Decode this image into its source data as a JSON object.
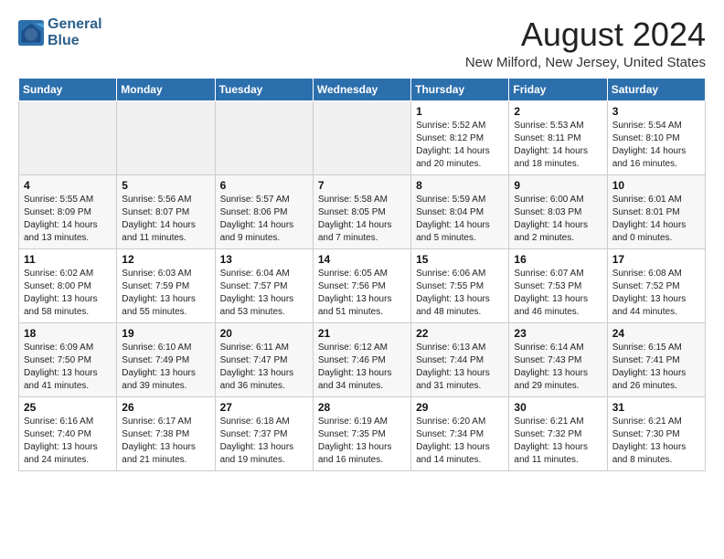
{
  "logo": {
    "line1": "General",
    "line2": "Blue"
  },
  "title": "August 2024",
  "location": "New Milford, New Jersey, United States",
  "weekdays": [
    "Sunday",
    "Monday",
    "Tuesday",
    "Wednesday",
    "Thursday",
    "Friday",
    "Saturday"
  ],
  "weeks": [
    [
      {
        "day": "",
        "info": ""
      },
      {
        "day": "",
        "info": ""
      },
      {
        "day": "",
        "info": ""
      },
      {
        "day": "",
        "info": ""
      },
      {
        "day": "1",
        "info": "Sunrise: 5:52 AM\nSunset: 8:12 PM\nDaylight: 14 hours\nand 20 minutes."
      },
      {
        "day": "2",
        "info": "Sunrise: 5:53 AM\nSunset: 8:11 PM\nDaylight: 14 hours\nand 18 minutes."
      },
      {
        "day": "3",
        "info": "Sunrise: 5:54 AM\nSunset: 8:10 PM\nDaylight: 14 hours\nand 16 minutes."
      }
    ],
    [
      {
        "day": "4",
        "info": "Sunrise: 5:55 AM\nSunset: 8:09 PM\nDaylight: 14 hours\nand 13 minutes."
      },
      {
        "day": "5",
        "info": "Sunrise: 5:56 AM\nSunset: 8:07 PM\nDaylight: 14 hours\nand 11 minutes."
      },
      {
        "day": "6",
        "info": "Sunrise: 5:57 AM\nSunset: 8:06 PM\nDaylight: 14 hours\nand 9 minutes."
      },
      {
        "day": "7",
        "info": "Sunrise: 5:58 AM\nSunset: 8:05 PM\nDaylight: 14 hours\nand 7 minutes."
      },
      {
        "day": "8",
        "info": "Sunrise: 5:59 AM\nSunset: 8:04 PM\nDaylight: 14 hours\nand 5 minutes."
      },
      {
        "day": "9",
        "info": "Sunrise: 6:00 AM\nSunset: 8:03 PM\nDaylight: 14 hours\nand 2 minutes."
      },
      {
        "day": "10",
        "info": "Sunrise: 6:01 AM\nSunset: 8:01 PM\nDaylight: 14 hours\nand 0 minutes."
      }
    ],
    [
      {
        "day": "11",
        "info": "Sunrise: 6:02 AM\nSunset: 8:00 PM\nDaylight: 13 hours\nand 58 minutes."
      },
      {
        "day": "12",
        "info": "Sunrise: 6:03 AM\nSunset: 7:59 PM\nDaylight: 13 hours\nand 55 minutes."
      },
      {
        "day": "13",
        "info": "Sunrise: 6:04 AM\nSunset: 7:57 PM\nDaylight: 13 hours\nand 53 minutes."
      },
      {
        "day": "14",
        "info": "Sunrise: 6:05 AM\nSunset: 7:56 PM\nDaylight: 13 hours\nand 51 minutes."
      },
      {
        "day": "15",
        "info": "Sunrise: 6:06 AM\nSunset: 7:55 PM\nDaylight: 13 hours\nand 48 minutes."
      },
      {
        "day": "16",
        "info": "Sunrise: 6:07 AM\nSunset: 7:53 PM\nDaylight: 13 hours\nand 46 minutes."
      },
      {
        "day": "17",
        "info": "Sunrise: 6:08 AM\nSunset: 7:52 PM\nDaylight: 13 hours\nand 44 minutes."
      }
    ],
    [
      {
        "day": "18",
        "info": "Sunrise: 6:09 AM\nSunset: 7:50 PM\nDaylight: 13 hours\nand 41 minutes."
      },
      {
        "day": "19",
        "info": "Sunrise: 6:10 AM\nSunset: 7:49 PM\nDaylight: 13 hours\nand 39 minutes."
      },
      {
        "day": "20",
        "info": "Sunrise: 6:11 AM\nSunset: 7:47 PM\nDaylight: 13 hours\nand 36 minutes."
      },
      {
        "day": "21",
        "info": "Sunrise: 6:12 AM\nSunset: 7:46 PM\nDaylight: 13 hours\nand 34 minutes."
      },
      {
        "day": "22",
        "info": "Sunrise: 6:13 AM\nSunset: 7:44 PM\nDaylight: 13 hours\nand 31 minutes."
      },
      {
        "day": "23",
        "info": "Sunrise: 6:14 AM\nSunset: 7:43 PM\nDaylight: 13 hours\nand 29 minutes."
      },
      {
        "day": "24",
        "info": "Sunrise: 6:15 AM\nSunset: 7:41 PM\nDaylight: 13 hours\nand 26 minutes."
      }
    ],
    [
      {
        "day": "25",
        "info": "Sunrise: 6:16 AM\nSunset: 7:40 PM\nDaylight: 13 hours\nand 24 minutes."
      },
      {
        "day": "26",
        "info": "Sunrise: 6:17 AM\nSunset: 7:38 PM\nDaylight: 13 hours\nand 21 minutes."
      },
      {
        "day": "27",
        "info": "Sunrise: 6:18 AM\nSunset: 7:37 PM\nDaylight: 13 hours\nand 19 minutes."
      },
      {
        "day": "28",
        "info": "Sunrise: 6:19 AM\nSunset: 7:35 PM\nDaylight: 13 hours\nand 16 minutes."
      },
      {
        "day": "29",
        "info": "Sunrise: 6:20 AM\nSunset: 7:34 PM\nDaylight: 13 hours\nand 14 minutes."
      },
      {
        "day": "30",
        "info": "Sunrise: 6:21 AM\nSunset: 7:32 PM\nDaylight: 13 hours\nand 11 minutes."
      },
      {
        "day": "31",
        "info": "Sunrise: 6:21 AM\nSunset: 7:30 PM\nDaylight: 13 hours\nand 8 minutes."
      }
    ]
  ]
}
